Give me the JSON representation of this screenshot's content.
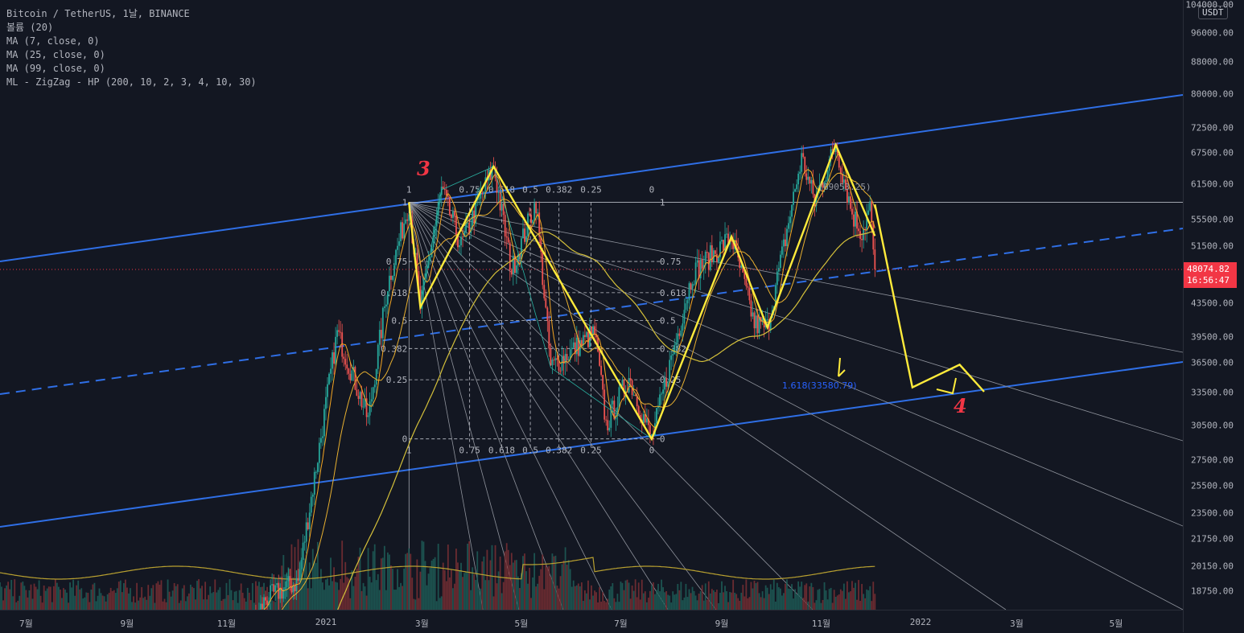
{
  "legend": {
    "symbol": "Bitcoin / TetherUS, 1날, BINANCE",
    "volume": "볼륨 (20)",
    "ma7": "MA (7, close, 0)",
    "ma25": "MA (25, close, 0)",
    "ma99": "MA (99, close, 0)",
    "zigzag": "ML - ZigZag - HP (200, 10, 2, 3, 4, 10, 30)"
  },
  "currency": "USDT",
  "price_badge": {
    "price": "48074.82",
    "countdown": "16:56:47",
    "color": "#f23645"
  },
  "wave_labels": {
    "wave3": "3",
    "wave4": "4"
  },
  "extension_label": "1.618(33580.79)",
  "zigzag_label": "(69053.25)",
  "colors": {
    "background": "#131722",
    "channel": "#2f6fe6",
    "zigzag": "#ffeb3b",
    "fib_lines": "#d1d4dc",
    "candle_up": "#26a69a",
    "candle_down": "#ef5350",
    "ma7": "#f5a623",
    "ma25": "#e8b030",
    "ma99": "#d4c03a",
    "volume_ma": "#b8a030",
    "wave_label": "#f23645",
    "extension": "#2962ff"
  },
  "chart_data": {
    "type": "line",
    "title": "Bitcoin / TetherUS, 1날, BINANCE",
    "y_scale": "log",
    "ylim": [
      17500,
      104000
    ],
    "y_ticks": [
      "104000.00",
      "96000.00",
      "88000.00",
      "80000.00",
      "72500.00",
      "67500.00",
      "61500.00",
      "55500.00",
      "51500.00",
      "43500.00",
      "39500.00",
      "36500.00",
      "33500.00",
      "30500.00",
      "27500.00",
      "25500.00",
      "23500.00",
      "21750.00",
      "20150.00",
      "18750.00"
    ],
    "x_ticks": [
      "7월",
      "9월",
      "11월",
      "2021",
      "3월",
      "5월",
      "7월",
      "9월",
      "11월",
      "2022",
      "3월",
      "5월"
    ],
    "last_price": 48074.82,
    "series": [
      {
        "name": "ML - ZigZag - HP (200, 10, 2, 3, 4, 10, 30)",
        "points": [
          [
            "2021-02-21",
            58350
          ],
          [
            "2021-02-28",
            43000
          ],
          [
            "2021-04-14",
            64800
          ],
          [
            "2021-07-20",
            29300
          ],
          [
            "2021-09-07",
            52900
          ],
          [
            "2021-09-29",
            40600
          ],
          [
            "2021-11-10",
            69053.25
          ],
          [
            "2021-12-04",
            53000
          ]
        ]
      },
      {
        "name": "projection",
        "points": [
          [
            "2021-12-04",
            58000
          ],
          [
            "2021-12-27",
            34000
          ],
          [
            "2022-01-25",
            36300
          ],
          [
            "2022-02-09",
            33580.79
          ]
        ]
      }
    ],
    "fibonacci": {
      "levels": [
        "1",
        "0.75",
        "0.618",
        "0.5",
        "0.382",
        "0.25",
        "0"
      ],
      "high": 58350,
      "low": 29300
    },
    "extension": {
      "level": "1.618",
      "value": 33580.79
    },
    "annotations": [
      "3",
      "4"
    ]
  }
}
